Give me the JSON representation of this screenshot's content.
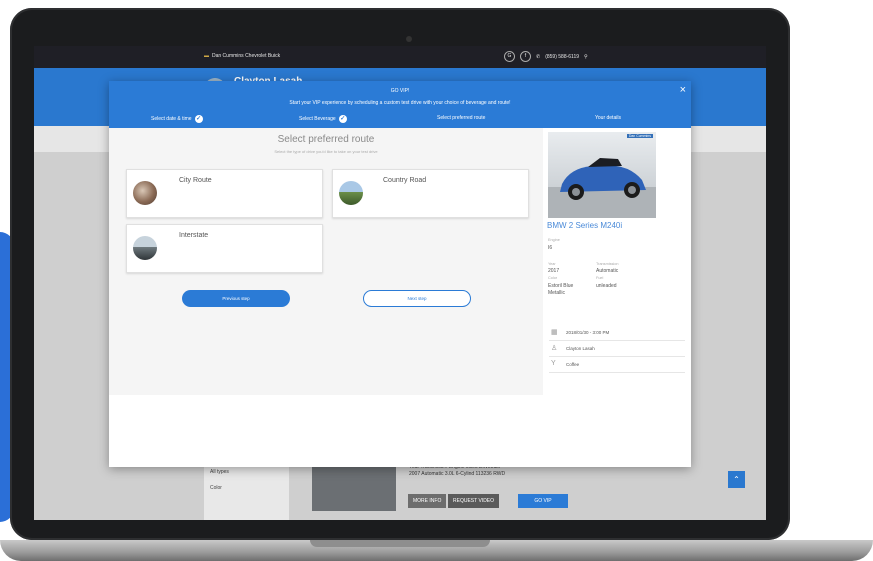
{
  "site": {
    "dealer_name": "Dan Cummins Chevrolet Buick",
    "phone": "(859) 588-6119",
    "salesperson_header": "Clayton Lasah"
  },
  "modal": {
    "title": "GO VIP!",
    "subtitle": "Start your VIP experience by scheduling a custom test drive with your choice of beverage and route!",
    "close_symbol": "×",
    "steps": [
      {
        "label": "Select date & time",
        "done": true
      },
      {
        "label": "Select Beverage",
        "done": true
      },
      {
        "label": "Select preferred route",
        "done": false
      },
      {
        "label": "Your details",
        "done": false
      }
    ],
    "route_title": "Select preferred route",
    "route_subtitle": "Select the type of drive you'd like to take on your test drive",
    "routes": [
      {
        "label": "City Route"
      },
      {
        "label": "Country Road"
      },
      {
        "label": "Interstate"
      }
    ],
    "prev_label": "Previous step",
    "next_label": "Next step"
  },
  "vehicle": {
    "badge": "Dan Cummins",
    "name": "BMW 2 Series M240i",
    "engine_label": "Engine",
    "engine": "I6",
    "year_label": "Year",
    "year": "2017",
    "transmission_label": "Transmission",
    "transmission": "Automatic",
    "color_label": "Color",
    "color": "Estoril Blue Metallic",
    "fuel_label": "Fuel",
    "fuel": "unleaded",
    "color_hex": "#2f63b8"
  },
  "summary": [
    {
      "icon": "calendar-icon",
      "glyph": "▦",
      "text": "2018/01/30 - 3:00 PM"
    },
    {
      "icon": "person-icon",
      "glyph": "♙",
      "text": "Clayton Lasah"
    },
    {
      "icon": "cocktail-icon",
      "glyph": "Y",
      "text": "Coffee"
    }
  ],
  "background_listing": {
    "filter_all": "All types",
    "filter_color": "Color",
    "spec_header": "Year   Transmiss...   Engine   Miles   Drivetrain",
    "spec_values": "2007   Automatic   3.0L 6-Cylind   113236   RWD",
    "more_info": "MORE INFO",
    "request_video": "REQUEST VIDEO",
    "go_vip": "GO VIP"
  },
  "colors": {
    "accent": "#2b7bd6",
    "topbar": "#1f1f26"
  }
}
